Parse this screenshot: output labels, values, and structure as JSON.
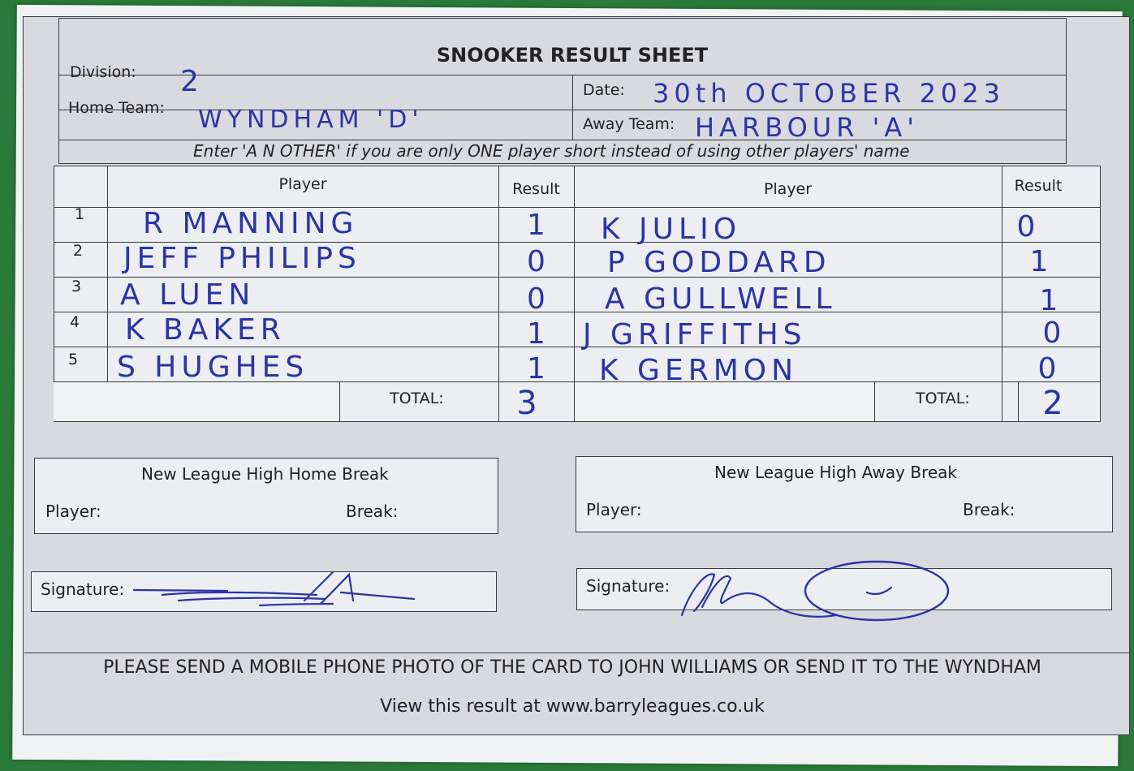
{
  "sheet": {
    "title": "SNOOKER RESULT SHEET",
    "division_label": "Division:",
    "division_value": "2",
    "date_label": "Date:",
    "date_value": "30th OCTOBER 2023",
    "home_team_label": "Home Team:",
    "home_team_value": "WYNDHAM 'D'",
    "away_team_label": "Away Team:",
    "away_team_value": "HARBOUR 'A'",
    "instruction": "Enter 'A N OTHER' if you are only ONE player short instead of using other players' name"
  },
  "table": {
    "home_player_header": "Player",
    "home_result_header": "Result",
    "away_player_header": "Player",
    "away_result_header": "Result",
    "rows": [
      {
        "num": "1",
        "home_player": "R MANNING",
        "home_result": "1",
        "away_player": "K JULIO",
        "away_result": "0"
      },
      {
        "num": "2",
        "home_player": "JEFF PHILIPS",
        "home_result": "0",
        "away_player": "P GODDARD",
        "away_result": "1"
      },
      {
        "num": "3",
        "home_player": "A LUEN",
        "home_result": "0",
        "away_player": "A GULLWELL",
        "away_result": "1"
      },
      {
        "num": "4",
        "home_player": "K BAKER",
        "home_result": "1",
        "away_player": "J GRIFFITHS",
        "away_result": "0"
      },
      {
        "num": "5",
        "home_player": "S HUGHES",
        "home_result": "1",
        "away_player": "K GERMON",
        "away_result": "0"
      }
    ],
    "total_label": "TOTAL:",
    "home_total": "3",
    "away_total": "2"
  },
  "breaks": {
    "home_title": "New League High Home Break",
    "away_title": "New League High Away Break",
    "player_label": "Player:",
    "break_label": "Break:"
  },
  "signature_label": "Signature:",
  "footer": {
    "line1": "PLEASE SEND A MOBILE PHONE PHOTO OF THE CARD TO JOHN WILLIAMS OR SEND IT TO THE WYNDHAM",
    "line2": "View this result at www.barryleagues.co.uk"
  },
  "colors": {
    "ink": "#2b34a6",
    "form_shade": "#d9dadf",
    "table_bg": "#2a7a3a"
  }
}
